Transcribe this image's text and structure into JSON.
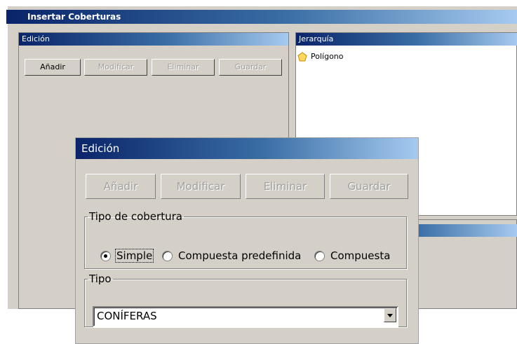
{
  "window": {
    "title": "Insertar Coberturas"
  },
  "edit_panel": {
    "title": "Edición",
    "buttons": {
      "add": "Añadir",
      "modify": "Modificar",
      "delete": "Eliminar",
      "save": "Guardar"
    }
  },
  "hierarchy": {
    "title": "Jerarquía",
    "items": [
      {
        "label": "Polígono",
        "icon": "pentagon-icon"
      }
    ]
  },
  "edit_dialog": {
    "title": "Edición",
    "buttons": {
      "add": "Añadir",
      "modify": "Modificar",
      "delete": "Eliminar",
      "save": "Guardar"
    },
    "coverage_type": {
      "legend": "Tipo de cobertura",
      "options": [
        "Simple",
        "Compuesta predefinida",
        "Compuesta"
      ],
      "selected": "Simple"
    },
    "type": {
      "legend": "Tipo",
      "value": "CONÍFERAS"
    }
  },
  "colors": {
    "title_start": "#0a246a",
    "title_end": "#a6caf0",
    "face": "#d4d0c8"
  }
}
